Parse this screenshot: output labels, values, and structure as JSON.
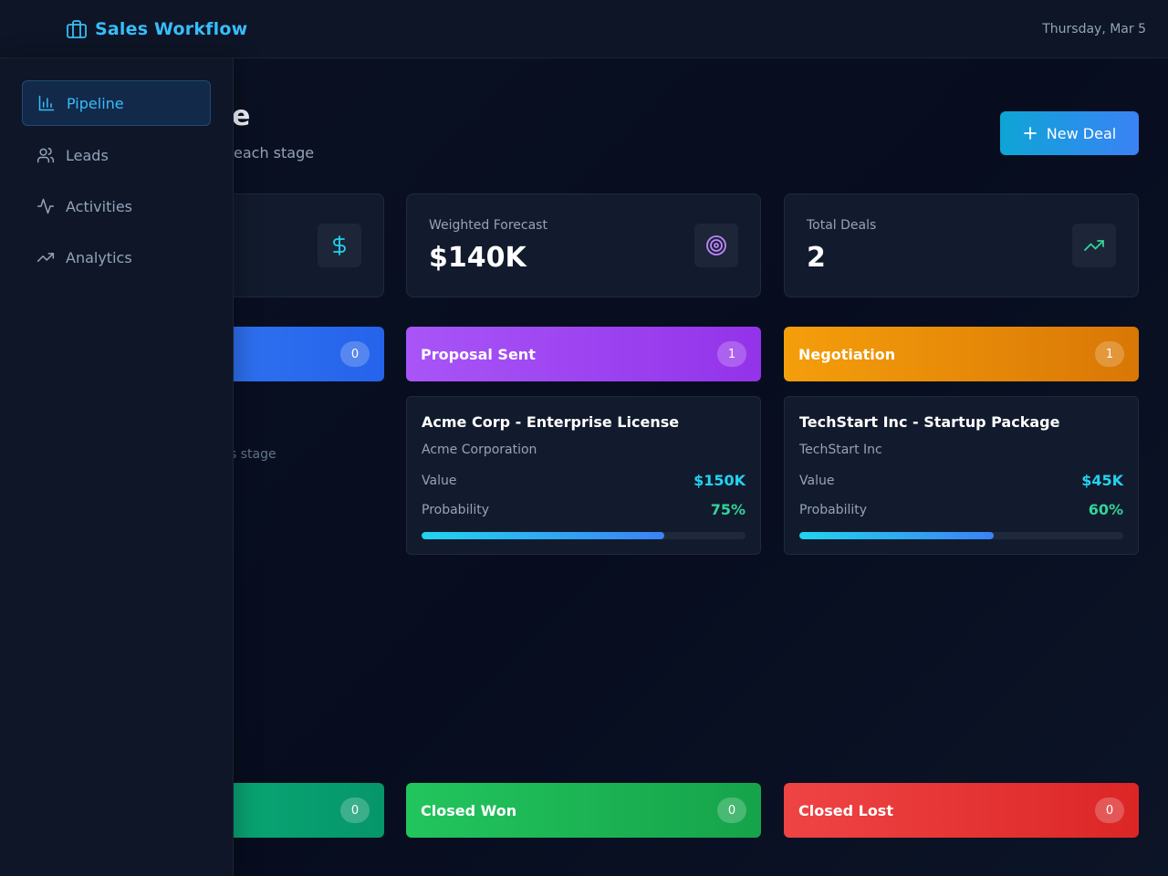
{
  "header": {
    "app_title": "Sales Workflow",
    "brand_icon": "briefcase-icon",
    "date": "Thursday, Mar 5"
  },
  "page": {
    "title_partial": "e",
    "subtitle_partial": "each stage",
    "new_deal_label": "New Deal"
  },
  "sidebar": {
    "items": [
      {
        "label": "Pipeline",
        "icon": "bar-chart-icon",
        "active": true
      },
      {
        "label": "Leads",
        "icon": "users-icon",
        "active": false
      },
      {
        "label": "Activities",
        "icon": "activity-icon",
        "active": false
      },
      {
        "label": "Analytics",
        "icon": "trending-up-icon",
        "active": false
      }
    ]
  },
  "stats": [
    {
      "label": "",
      "value": "",
      "icon": "dollar-icon",
      "icon_color": "#22d3ee"
    },
    {
      "label": "Weighted Forecast",
      "value": "$140K",
      "icon": "target-icon",
      "icon_color": "#c084fc"
    },
    {
      "label": "Total Deals",
      "value": "2",
      "icon": "trending-up-icon",
      "icon_color": "#34d399"
    }
  ],
  "stages_top": [
    {
      "name": "",
      "count": "0",
      "color": "#2f6fea"
    },
    {
      "name": "Proposal Sent",
      "count": "1",
      "color": "#a855f7"
    },
    {
      "name": "Negotiation",
      "count": "1",
      "color": "#f59e0b"
    }
  ],
  "stages_bottom": [
    {
      "name": "",
      "count": "0",
      "color": "#0a9e73"
    },
    {
      "name": "Closed Won",
      "count": "0",
      "color": "#22c55e"
    },
    {
      "name": "Closed Lost",
      "count": "0",
      "color": "#ef4444"
    }
  ],
  "empty_note_partial": "s stage",
  "deals": [
    {
      "title": "Acme Corp - Enterprise License",
      "company": "Acme Corporation",
      "value_label": "Value",
      "value": "$150K",
      "probability_label": "Probability",
      "probability": "75%",
      "progress": 0.75
    },
    {
      "title": "TechStart Inc - Startup Package",
      "company": "TechStart Inc",
      "value_label": "Value",
      "value": "$45K",
      "probability_label": "Probability",
      "probability": "60%",
      "progress": 0.6
    }
  ],
  "colors": {
    "accent": "#38bdf8",
    "background": "#0b1224",
    "card": "#121b2d"
  }
}
